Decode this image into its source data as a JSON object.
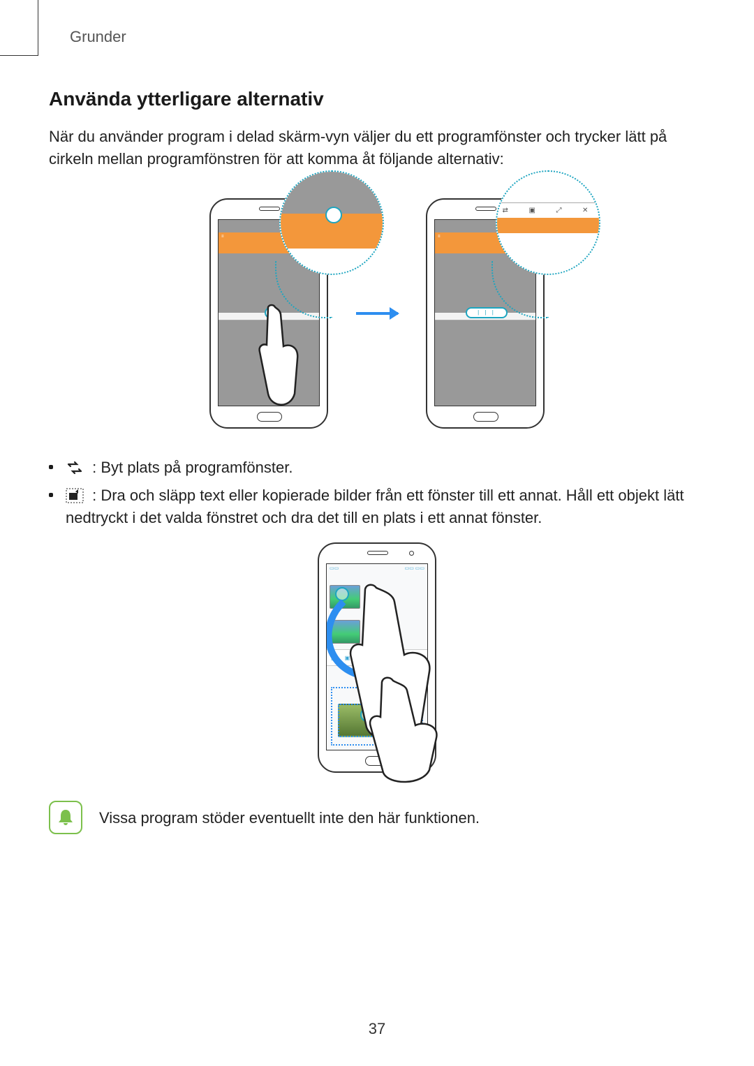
{
  "breadcrumb": "Grunder",
  "heading": "Använda ytterligare alternativ",
  "intro": "När du använder program i delad skärm-vyn väljer du ett programfönster och trycker lätt på cirkeln mellan programfönstren för att komma åt följande alternativ:",
  "bullets": [
    {
      "icon_name": "swap-windows-icon",
      "text": " : Byt plats på programfönster."
    },
    {
      "icon_name": "drag-content-icon",
      "text": " : Dra och släpp text eller kopierade bilder från ett fönster till ett annat. Håll ett objekt lätt nedtryckt i det valda fönstret och dra det till en plats i ett annat fönster."
    }
  ],
  "note": "Vissa program stöder eventuellt inte den här funktionen.",
  "page_number": "37"
}
